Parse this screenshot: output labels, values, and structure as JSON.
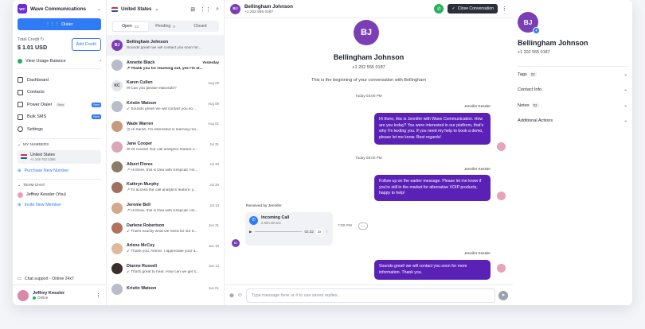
{
  "workspace": {
    "initials": "WC",
    "name": "Wave Communications"
  },
  "sidebar": {
    "dialer_label": "Dialer",
    "credit_label": "Total Credit",
    "credit_value": "$ 1.01 USD",
    "add_credit_label": "Add Credit",
    "usage_label": "View Usage Balance",
    "nav": [
      {
        "label": "Dashboard"
      },
      {
        "label": "Contacts"
      },
      {
        "label": "Power Dialer",
        "beta": "Beta",
        "badge": "New"
      },
      {
        "label": "Bulk SMS",
        "badge": "New"
      },
      {
        "label": "Settings"
      }
    ],
    "my_numbers_header": "MY NUMBERS",
    "number_country": "United States",
    "number_value": "+1 248 762 0356",
    "purchase_label": "Purchase New Number",
    "team_chat_header": "TEAM CHAT",
    "team_member": "Jeffrey Kessler (You)",
    "invite_label": "Invite New Member",
    "support_label": "Chat support - Online 24x7",
    "user_name": "Jeffrey Kessler",
    "user_status": "Online"
  },
  "list": {
    "country": "United States",
    "tabs": [
      {
        "label": "Open",
        "count": "13"
      },
      {
        "label": "Pending",
        "count": "0"
      },
      {
        "label": "Closed",
        "count": ""
      }
    ],
    "conversations": [
      {
        "initials": "BJ",
        "color": "#7b3fb5",
        "name": "Bellingham Johnson",
        "date": "",
        "preview": "Sounds great! we will contact you soon for...",
        "bold": false
      },
      {
        "initials": "",
        "color": "#b9bdc9",
        "name": "Annette Black",
        "date": "Yesterday",
        "preview": "↗ Thank you for reaching out, yes I'm st...",
        "bold": true
      },
      {
        "initials": "KC",
        "color": "#e4e6ec",
        "name": "Karen Cullen",
        "date": "Aug 09",
        "preview": "✉ Can you please elaborate?",
        "bold": false
      },
      {
        "initials": "",
        "color": "#b9bdc9",
        "name": "Kristin Watson",
        "date": "Aug 09",
        "preview": "↙ Sounds great! we will contact you so...",
        "bold": false
      },
      {
        "initials": "",
        "color": "#c79a7e",
        "name": "Wade Warren",
        "date": "Aug 01",
        "preview": "◷ Hi Sarah, I'm interested in learning mo...",
        "bold": false
      },
      {
        "initials": "",
        "color": "#d9a7b6",
        "name": "Jane Cooper",
        "date": "Jul 31",
        "preview": "✉ Of course! Our call analytics feature o...",
        "bold": false
      },
      {
        "initials": "",
        "color": "#8c7b6a",
        "name": "Albert Flores",
        "date": "Jul 30",
        "preview": "↗ Hi there, this is Dea with Krispcall. Ho...",
        "bold": false
      },
      {
        "initials": "",
        "color": "#a07060",
        "name": "Kathryn Murphy",
        "date": "Jul 29",
        "preview": "↗ To access the call analytics feature, y...",
        "bold": false
      },
      {
        "initials": "",
        "color": "#d4a88a",
        "name": "Jerome Bell",
        "date": "Jul 10",
        "preview": "↗ Hi there, this is Dea with Krispcall. Ho...",
        "bold": false
      },
      {
        "initials": "",
        "color": "#b3715e",
        "name": "Darlene Robertson",
        "date": "Jun 21",
        "preview": "↙ That's exactly what we need for our b...",
        "bold": false
      },
      {
        "initials": "",
        "color": "#e0b89a",
        "name": "Arlene McCoy",
        "date": "Jun 19",
        "preview": "↙ Thank you, Arlene. I appreciate your a...",
        "bold": false
      },
      {
        "initials": "",
        "color": "#3a2f2a",
        "name": "Dianne Russell",
        "date": "Jun 14",
        "preview": "↙ That's great to hear. How can we get s...",
        "bold": false
      },
      {
        "initials": "",
        "color": "#b9bdc9",
        "name": "Kristin Watson",
        "date": "Jun 01",
        "preview": "",
        "bold": false
      }
    ]
  },
  "chat": {
    "contact_initials": "BJ",
    "contact_name": "Bellingham Johnson",
    "contact_phone": "+1 202 555 0187",
    "close_label": "Close Conversation",
    "intro": "This is the beginning of your conversation with Bellingham",
    "date1": "Today 03:00 PM",
    "sender1": "Jennifer Kessler",
    "msg1": "Hi there, this is Jennifer with Wave Communication. How are you today? You were interested in our platform, that's why I'm texting you. If you need my help to book a demo, please let me know. Best regards!",
    "date2": "Today 06:00 PM",
    "sender2": "Jennifer Kessler",
    "msg2": "Follow up on the earlier message. Please let me know if you're still in the market for alternative VOIP products, happy to help!",
    "received_label": "Received by Jennifer",
    "call_title": "Incoming Call",
    "call_duration": "2 min 32 sec",
    "call_audio_time": "02:32",
    "call_speed": "2x",
    "call_time": "7:00 PM",
    "sender3": "Jennifer Kessler",
    "msg3": "Sounds great! we will contact you soon for more information. Thank you.",
    "composer_placeholder": "Type message here or # to use saved replies.."
  },
  "details": {
    "initials": "BJ",
    "name": "Bellingham Johnson",
    "phone": "+1 202 555 0187",
    "sections": [
      {
        "label": "Tags",
        "count": "02"
      },
      {
        "label": "Contact Info",
        "count": ""
      },
      {
        "label": "Notes",
        "count": "02"
      },
      {
        "label": "Additional Actions",
        "count": ""
      }
    ]
  }
}
